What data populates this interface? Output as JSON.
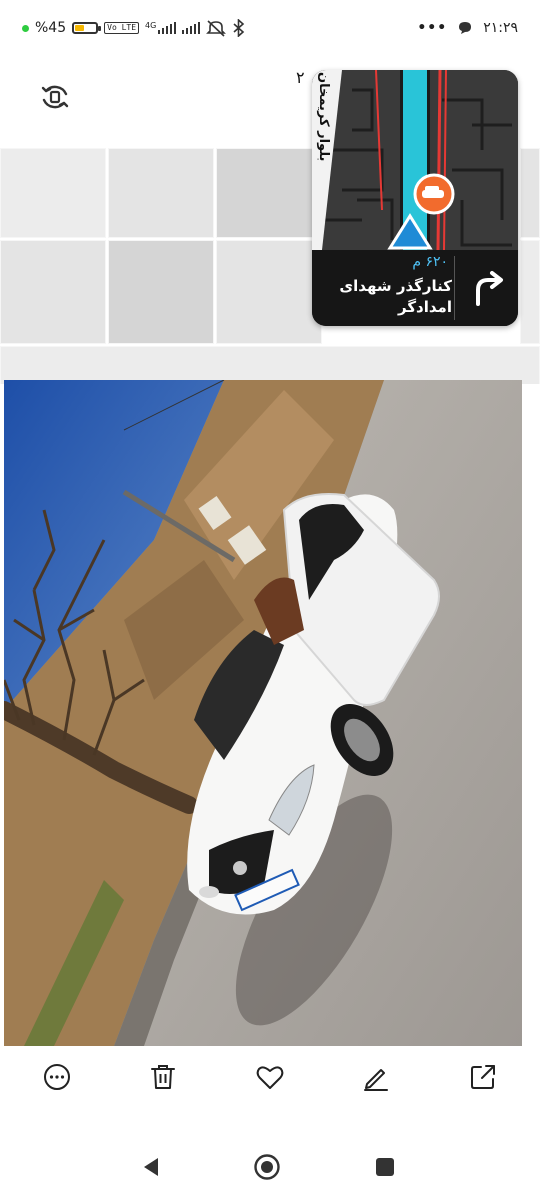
{
  "status_bar": {
    "battery_text": "%45",
    "battery_level": 0.45,
    "network_badge": "4G",
    "volte_badge": "Vo LTE",
    "time": "۲۱:۲۹",
    "icons": [
      "dot-indicator",
      "battery-icon",
      "volte-icon",
      "signal-icon",
      "signal-icon",
      "mute-icon",
      "bluetooth-icon",
      "more-dots-icon",
      "chat-bubble-icon"
    ]
  },
  "header": {
    "rotate_icon": "rotate-icon",
    "page_counter": "۲"
  },
  "navigation_card": {
    "distance": "۶۲۰ م",
    "street": "کنارگذر شهدای امدادگر",
    "map_label": "بلوار کریمخان",
    "turn_icon": "turn-right-arrow-icon",
    "colors": {
      "route": "#29c4d8",
      "card_bg": "#161616",
      "distance": "#4fc3f7"
    }
  },
  "photo": {
    "subject": "photo-white-sedan"
  },
  "toolbar": {
    "items": [
      {
        "name": "more-button",
        "icon": "more-horizontal-icon"
      },
      {
        "name": "delete-button",
        "icon": "trash-icon"
      },
      {
        "name": "favorite-button",
        "icon": "heart-icon"
      },
      {
        "name": "edit-button",
        "icon": "pencil-icon"
      },
      {
        "name": "share-button",
        "icon": "external-share-icon"
      }
    ]
  },
  "system_nav": {
    "items": [
      "back-icon",
      "home-icon",
      "recents-icon"
    ]
  }
}
